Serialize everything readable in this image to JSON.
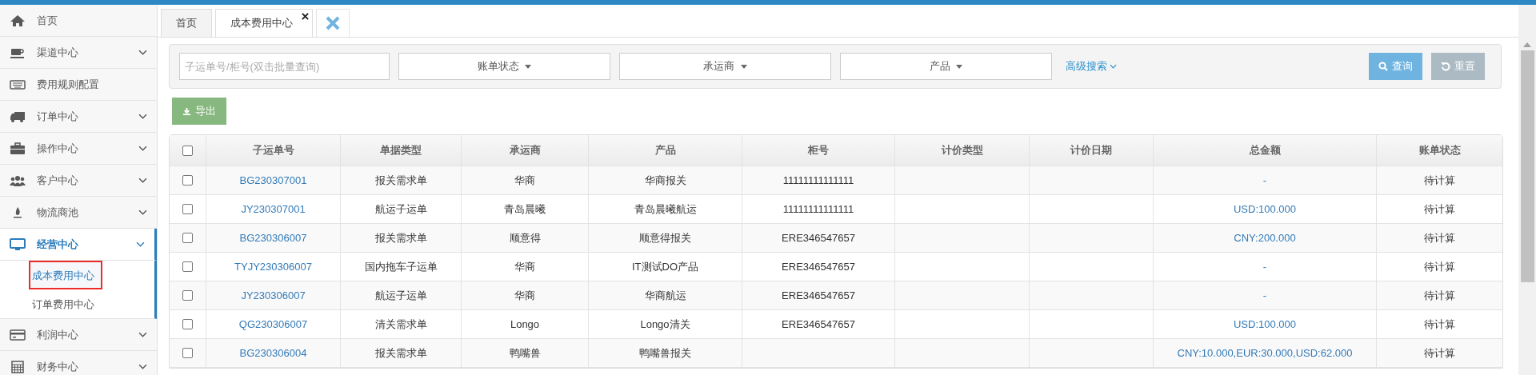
{
  "sidebar": {
    "items": [
      {
        "label": "首页",
        "selected": false,
        "kind": "link"
      },
      {
        "label": "渠道中心",
        "selected": false,
        "kind": "group"
      },
      {
        "label": "费用规则配置",
        "selected": false,
        "kind": "link"
      },
      {
        "label": "订单中心",
        "selected": false,
        "kind": "group"
      },
      {
        "label": "操作中心",
        "selected": false,
        "kind": "group"
      },
      {
        "label": "客户中心",
        "selected": false,
        "kind": "group"
      },
      {
        "label": "物流商池",
        "selected": false,
        "kind": "group"
      },
      {
        "label": "经营中心",
        "selected": true,
        "kind": "group",
        "expanded": true,
        "children": [
          {
            "label": "成本费用中心",
            "selected": true
          },
          {
            "label": "订单费用中心",
            "selected": false
          }
        ]
      },
      {
        "label": "利润中心",
        "selected": false,
        "kind": "group"
      },
      {
        "label": "财务中心",
        "selected": false,
        "kind": "group"
      }
    ]
  },
  "tabs": [
    {
      "label": "首页",
      "selected": false,
      "closable": false
    },
    {
      "label": "成本费用中心",
      "selected": true,
      "closable": true
    }
  ],
  "filters": {
    "search": {
      "placeholder": "子运单号/柜号(双击批量查询)"
    },
    "dropdowns": [
      "账单状态",
      "承运商",
      "产品"
    ],
    "advanced_link": "高级搜索",
    "buttons": [
      {
        "label": "查询",
        "kind": "primary"
      },
      {
        "label": "重置",
        "kind": "reset"
      }
    ]
  },
  "export_button": "导出",
  "table": {
    "select_all": false,
    "columns": [
      "子运单号",
      "单据类型",
      "承运商",
      "产品",
      "柜号",
      "计价类型",
      "计价日期",
      "总金额",
      "账单状态"
    ],
    "rows": [
      {
        "checked": false,
        "cells": [
          "BG230307001",
          "报关需求单",
          "华商",
          "华商报关",
          "11111111111111",
          "",
          "",
          "-",
          "待计算"
        ]
      },
      {
        "checked": false,
        "cells": [
          "JY230307001",
          "航运子运单",
          "青岛晨曦",
          "青岛晨曦航运",
          "11111111111111",
          "",
          "",
          "USD:100.000",
          "待计算"
        ]
      },
      {
        "checked": false,
        "cells": [
          "BG230306007",
          "报关需求单",
          "顺意得",
          "顺意得报关",
          "ERE346547657",
          "",
          "",
          "CNY:200.000",
          "待计算"
        ]
      },
      {
        "checked": false,
        "cells": [
          "TYJY230306007",
          "国内拖车子运单",
          "华商",
          "IT测试DO产品",
          "ERE346547657",
          "",
          "",
          "-",
          "待计算"
        ]
      },
      {
        "checked": false,
        "cells": [
          "JY230306007",
          "航运子运单",
          "华商",
          "华商航运",
          "ERE346547657",
          "",
          "",
          "-",
          "待计算"
        ]
      },
      {
        "checked": false,
        "cells": [
          "QG230306007",
          "清关需求单",
          "Longo",
          "Longo清关",
          "ERE346547657",
          "",
          "",
          "USD:100.000",
          "待计算"
        ]
      },
      {
        "checked": false,
        "cells": [
          "BG230306004",
          "报关需求单",
          "鸭嘴兽",
          "鸭嘴兽报关",
          "",
          "",
          "",
          "CNY:10.000,EUR:30.000,USD:62.000",
          "待计算"
        ]
      }
    ]
  }
}
